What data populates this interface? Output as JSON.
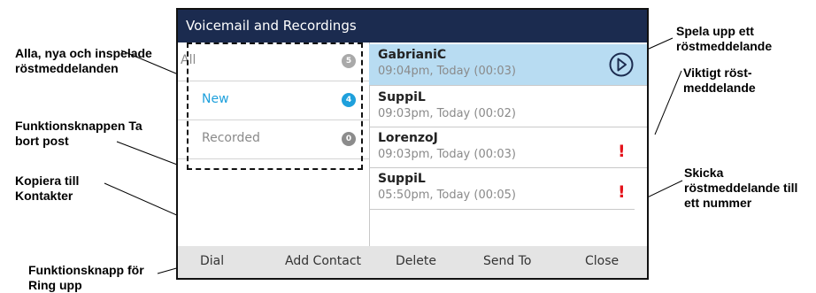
{
  "title": "Voicemail and Recordings",
  "filters": [
    {
      "label": "All",
      "count": "5",
      "color": "#888888",
      "badge_color": "#a9a9a9"
    },
    {
      "label": "New",
      "count": "4",
      "color": "#1ea0dc",
      "badge_color": "#1ea0dc"
    },
    {
      "label": "Recorded",
      "count": "0",
      "color": "#888888",
      "badge_color": "#8c8c8c"
    }
  ],
  "messages": [
    {
      "name": "GabrianiC",
      "meta": "09:04pm, Today (00:03)",
      "selected": true,
      "urgent": false
    },
    {
      "name": "SuppiL",
      "meta": "09:03pm, Today (00:02)",
      "selected": false,
      "urgent": false
    },
    {
      "name": "LorenzoJ",
      "meta": "09:03pm, Today (00:03)",
      "selected": false,
      "urgent": true
    },
    {
      "name": "SuppiL",
      "meta": "05:50pm, Today (00:05)",
      "selected": false,
      "urgent": true
    }
  ],
  "urgent_symbol": "!",
  "softkeys": [
    "Dial",
    "Add Contact",
    "Delete",
    "Send To",
    "Close"
  ],
  "callouts": {
    "alla": "Alla, nya och inspelade röstmeddelanden",
    "delete": "Funktionsknappen Ta bort post",
    "copy": "Kopiera till Kontakter",
    "dial": "Funktionsknapp för Ring upp",
    "play": "Spela upp ett röstmeddelande",
    "important": "Viktigt röst-meddelande",
    "send": "Skicka röstmeddelande till ett nummer"
  },
  "colors": {
    "titlebar": "#1b2b4f",
    "selected_row": "#b8dcf2",
    "urgent": "#e4131b",
    "softkey_bar": "#e4e4e4"
  },
  "icons": {
    "play": "play-circle-icon"
  }
}
